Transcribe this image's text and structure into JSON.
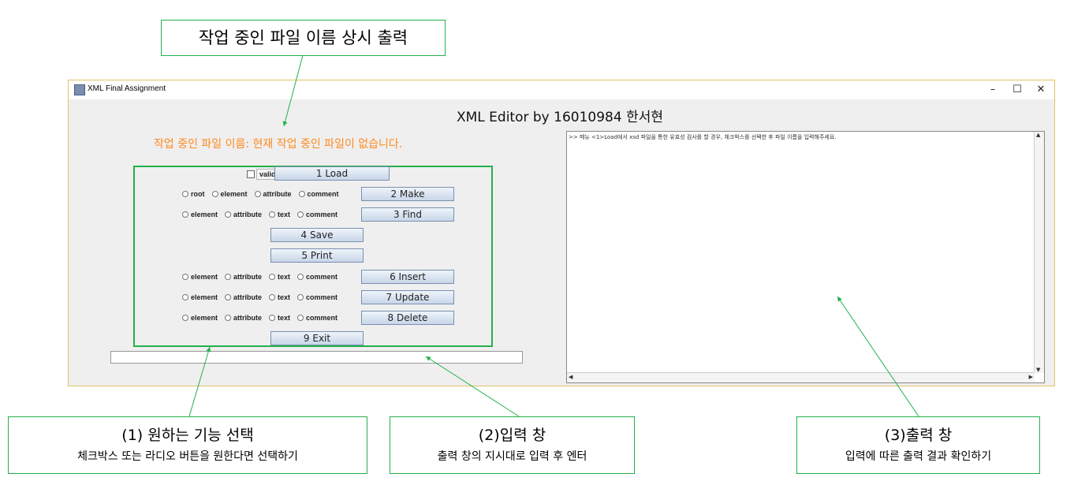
{
  "callouts": {
    "top": "작업 중인 파일 이름 상시 출력",
    "c1_title": "(1) 원하는 기능 선택",
    "c1_desc": "체크박스 또는 라디오 버튼을 원한다면 선택하기",
    "c2_title": "(2)입력 창",
    "c2_desc": "출력 창의 지시대로 입력 후 엔터",
    "c3_title": "(3)출력 창",
    "c3_desc": "입력에 따른 출력 결과 확인하기"
  },
  "window": {
    "title": "XML Final Assignment",
    "minimize": "–",
    "maximize": "☐",
    "close": "✕"
  },
  "app": {
    "heading": "XML Editor by 16010984 한서현",
    "current_file": "작업 중인 파일 이름: 현재 작업 중인 파일이 없습니다."
  },
  "controls": {
    "validation_label": "validation",
    "load": "1 Load",
    "make_options": [
      "root",
      "element",
      "attribute",
      "comment"
    ],
    "make": "2 Make",
    "find_options": [
      "element",
      "attribute",
      "text",
      "comment"
    ],
    "find": "3 Find",
    "save": "4 Save",
    "print": "5 Print",
    "insert_options": [
      "element",
      "attribute",
      "text",
      "comment"
    ],
    "insert": "6 Insert",
    "update_options": [
      "element",
      "attribute",
      "text",
      "comment"
    ],
    "update": "7 Update",
    "delete_options": [
      "element",
      "attribute",
      "text",
      "comment"
    ],
    "delete": "8 Delete",
    "exit": "9 Exit"
  },
  "input": {
    "value": ""
  },
  "output": {
    "text": ">> 메뉴 <1>Load에서 xsd 파일을 통한 유효성 검사를 할 경우, 체크박스를 선택한 후 파일 이름을 입력해주세요."
  },
  "colors": {
    "accent_green": "#22b14c",
    "file_orange": "#ff8a1c"
  }
}
